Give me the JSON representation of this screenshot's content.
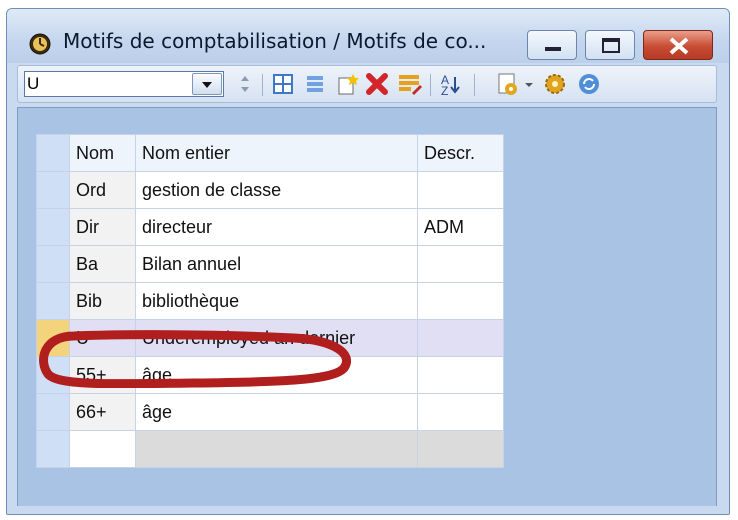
{
  "window": {
    "title": "Motifs de comptabilisation / Motifs de co...",
    "controls": [
      "minimize",
      "maximize",
      "close"
    ]
  },
  "toolbar": {
    "filter": {
      "value": "U"
    },
    "icons": [
      "dropdown-icon",
      "spin-icon",
      "grid-icon",
      "list-icon",
      "new-icon",
      "delete-icon",
      "edit-icon",
      "sort-icon",
      "document-icon",
      "settings-icon",
      "refresh-icon"
    ]
  },
  "table": {
    "columns": [
      "Nom",
      "Nom entier",
      "Descr."
    ],
    "rows": [
      {
        "nom": "Ord",
        "full": "gestion de classe",
        "desc": ""
      },
      {
        "nom": "Dir",
        "full": "directeur",
        "desc": "ADM"
      },
      {
        "nom": "Ba",
        "full": "Bilan annuel",
        "desc": ""
      },
      {
        "nom": "Bib",
        "full": "bibliothèque",
        "desc": ""
      },
      {
        "nom": "U",
        "full": "Underemployed an dernier",
        "desc": ""
      },
      {
        "nom": "55+",
        "full": "âge",
        "desc": ""
      },
      {
        "nom": "66+",
        "full": "âge",
        "desc": ""
      }
    ]
  },
  "colors": {
    "highlight": "#b01e1e",
    "current_row": "#e1dff3",
    "current_marker": "#f3d37c"
  }
}
